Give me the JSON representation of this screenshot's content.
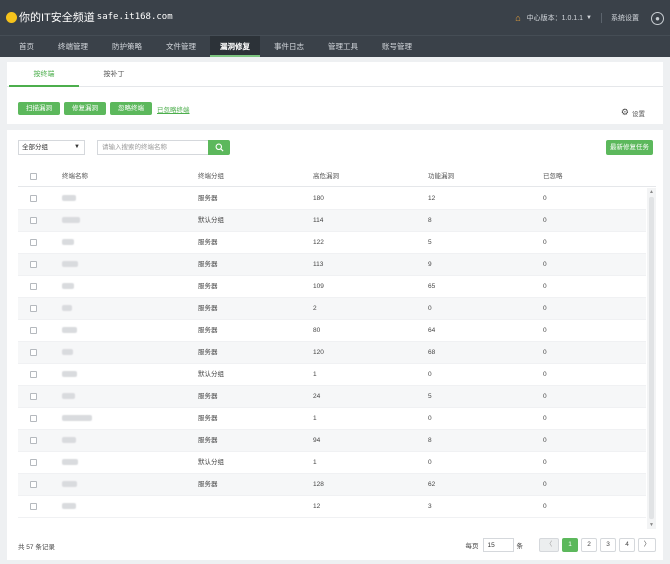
{
  "brand": {
    "text": "你的IT安全频道",
    "url": "safe.it168.com"
  },
  "top_right": {
    "center_version": "中心版本：1.0.1.1",
    "settings": "系统设置"
  },
  "nav": [
    {
      "label": "首页"
    },
    {
      "label": "终端管理"
    },
    {
      "label": "防护策略"
    },
    {
      "label": "文件管理"
    },
    {
      "label": "漏洞修复",
      "active": true
    },
    {
      "label": "事件日志"
    },
    {
      "label": "管理工具"
    },
    {
      "label": "账号管理"
    }
  ],
  "subtabs": [
    {
      "label": "按终端",
      "active": true
    },
    {
      "label": "按补丁"
    }
  ],
  "actions": {
    "scan": "扫描漏洞",
    "fix": "修复漏洞",
    "ignore": "忽略终端",
    "ignored_link": "已忽略终端",
    "settings": "设置"
  },
  "filter": {
    "group_selected": "全部分组",
    "search_placeholder": "请输入搜索的终端名称",
    "latest_task": "最新修复任务"
  },
  "table": {
    "headers": {
      "name": "终端名称",
      "group": "终端分组",
      "high": "高危漏洞",
      "func": "功能漏洞",
      "ignored": "已忽略"
    },
    "rows": [
      {
        "group": "服务器",
        "high": "180",
        "func": "12",
        "ignored": "0"
      },
      {
        "group": "默认分组",
        "high": "114",
        "func": "8",
        "ignored": "0"
      },
      {
        "group": "服务器",
        "high": "122",
        "func": "5",
        "ignored": "0"
      },
      {
        "group": "服务器",
        "high": "113",
        "func": "9",
        "ignored": "0"
      },
      {
        "group": "服务器",
        "high": "109",
        "func": "65",
        "ignored": "0"
      },
      {
        "group": "服务器",
        "high": "2",
        "func": "0",
        "ignored": "0"
      },
      {
        "group": "服务器",
        "high": "80",
        "func": "64",
        "ignored": "0"
      },
      {
        "group": "服务器",
        "high": "120",
        "func": "68",
        "ignored": "0"
      },
      {
        "group": "默认分组",
        "high": "1",
        "func": "0",
        "ignored": "0"
      },
      {
        "group": "服务器",
        "high": "24",
        "func": "5",
        "ignored": "0"
      },
      {
        "group": "服务器",
        "high": "1",
        "func": "0",
        "ignored": "0"
      },
      {
        "group": "服务器",
        "high": "94",
        "func": "8",
        "ignored": "0"
      },
      {
        "group": "默认分组",
        "high": "1",
        "func": "0",
        "ignored": "0"
      },
      {
        "group": "服务器",
        "high": "128",
        "func": "62",
        "ignored": "0"
      },
      {
        "group": "",
        "high": "12",
        "func": "3",
        "ignored": "0"
      }
    ]
  },
  "footer": {
    "total": "共 57 条记录",
    "per_page_label": "每页",
    "per_page": "15",
    "per_page_unit": "条",
    "prev": "〈",
    "pages": [
      "1",
      "2",
      "3",
      "4"
    ],
    "current_page": "1",
    "next": "〉"
  },
  "icons": {
    "home": "home-icon",
    "user": "user-icon",
    "gear": "gear-icon",
    "search": "search-icon"
  },
  "colors": {
    "topbar": "#3a4149",
    "accent": "#5cb85c"
  }
}
